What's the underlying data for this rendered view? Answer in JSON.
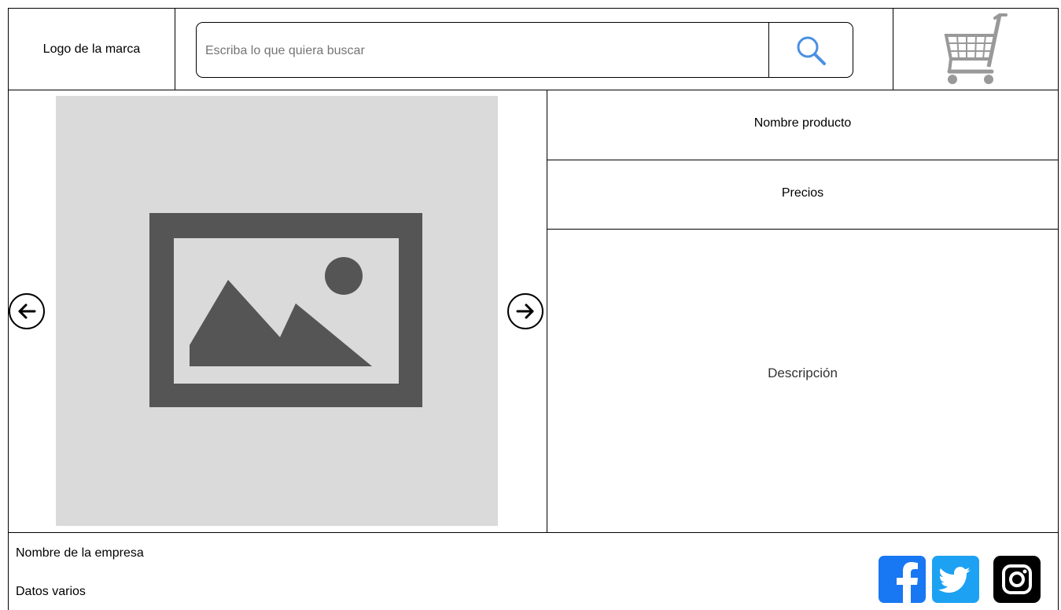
{
  "header": {
    "logo_text": "Logo de la marca",
    "search": {
      "placeholder": "Escriba lo que quiera buscar",
      "value": ""
    },
    "search_button_icon": "search-icon",
    "cart_icon": "shopping-cart-icon"
  },
  "gallery": {
    "image_icon": "image-placeholder-icon",
    "prev_icon": "arrow-left-icon",
    "next_icon": "arrow-right-icon"
  },
  "product": {
    "name_label": "Nombre producto",
    "price_label": "Precios",
    "description_label": "Descripción"
  },
  "footer": {
    "company_name": "Nombre de la empresa",
    "misc_data": "Datos varios",
    "social": [
      {
        "icon": "facebook-icon",
        "color": "#1877f2"
      },
      {
        "icon": "twitter-icon",
        "color": "#1da1f2"
      },
      {
        "icon": "instagram-icon",
        "color": "#000000"
      }
    ]
  },
  "colors": {
    "border": "#000000",
    "placeholder_bg": "#dadada",
    "placeholder_art": "#555555",
    "search_icon": "#4a90e2",
    "cart_icon": "#999999"
  }
}
